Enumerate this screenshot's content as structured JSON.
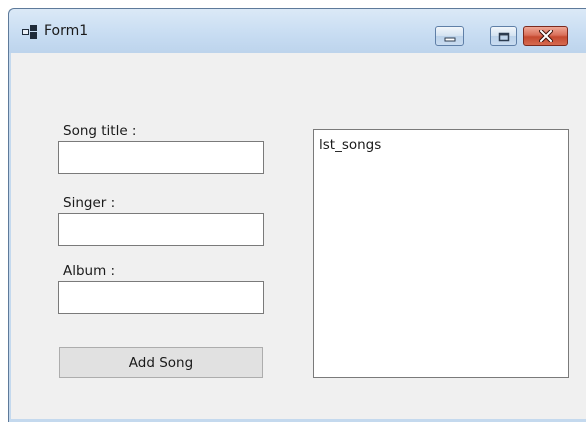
{
  "window": {
    "title": "Form1",
    "icon": "form-window-icon"
  },
  "caption_buttons": {
    "minimize_icon": "minimize-icon",
    "maximize_icon": "maximize-icon",
    "close_icon": "close-icon"
  },
  "form": {
    "song_title_label": "Song title :",
    "song_title_value": "",
    "singer_label": "Singer :",
    "singer_value": "",
    "album_label": "Album :",
    "album_value": "",
    "add_button_label": "Add Song"
  },
  "listbox": {
    "items": [
      "lst_songs"
    ]
  }
}
